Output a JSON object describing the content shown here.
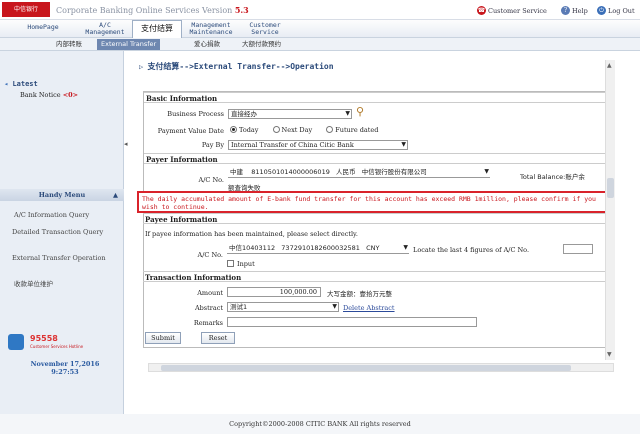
{
  "header": {
    "logo": "中信银行",
    "app_title": "Corporate Banking Online Services Version ",
    "version": "5.3",
    "links": {
      "customer_service": "Customer Service",
      "help": "Help",
      "logout": "Log Out"
    }
  },
  "nav": {
    "tabs": [
      {
        "label": "HomePage"
      },
      {
        "label": "A/C Management"
      },
      {
        "label": "支付结算"
      },
      {
        "label": "Management Maintenance"
      },
      {
        "label": "Customer Service"
      }
    ],
    "subtabs": [
      {
        "label": "内部转账"
      },
      {
        "label": "External Transfer"
      },
      {
        "label": "爱心捐款"
      },
      {
        "label": "大额付款预约"
      }
    ]
  },
  "sidebar": {
    "latest": "Latest",
    "bank_notice": "Bank Notice",
    "notice_count": "<0>",
    "handy_menu": "Handy Menu",
    "items": [
      {
        "label": "A/C Information Query"
      },
      {
        "label": "Detailed Transaction Query"
      },
      {
        "label": "External Transfer Operation"
      },
      {
        "label": "收款单位维护"
      }
    ],
    "hotline": "95558",
    "hotline_sub": "Customer Services Hotline",
    "date": "November 17,2016",
    "time": "9:27:53"
  },
  "main": {
    "breadcrumb": "支付结算-->External Transfer-->Operation",
    "basic": {
      "title": "Basic Information",
      "business_process_label": "Business Process",
      "business_process_value": "直接经办",
      "value_date_label": "Payment Value Date",
      "opt_today": "Today",
      "opt_next": "Next Day",
      "opt_future": "Future dated",
      "pay_by_label": "Pay By",
      "pay_by_value": "Internal Transfer of China Citic Bank"
    },
    "payer": {
      "title": "Payer Information",
      "ac_label": "A/C No.",
      "ac_bank": "中建",
      "ac_number": "8110501014000006019",
      "currency": "人民币",
      "ac_name": "中信银行股份有限公司",
      "balance_label": "Total Balance:账户余",
      "balance_cont": "额查询失败"
    },
    "alert": "The daily accumulated amount of E-bank fund transfer for this account has exceed RMB 1million, please confirm if you wish to continue.",
    "payee": {
      "title": "Payee Information",
      "note": "If payee information has been maintained, please select directly.",
      "ac_label": "A/C No.",
      "ac_value": "中信10403112",
      "ac_number": "7372910182600032581",
      "ac_currency": "CNY",
      "locate_label": "Locate the last 4 figures of A/C No.",
      "input_label": "Input"
    },
    "transaction": {
      "title": "Transaction Information",
      "amount_label": "Amount",
      "amount_value": "100,000.00",
      "amount_upper": "大写金额：壹拾万元整",
      "abstract_label": "Abstract",
      "abstract_value": "测试1",
      "delete_abstract": "Delete Abstract",
      "remarks_label": "Remarks"
    },
    "buttons": {
      "submit": "Submit",
      "reset": "Reset"
    }
  },
  "footer": "Copyright©2000-2008 CITIC BANK All rights reserved"
}
